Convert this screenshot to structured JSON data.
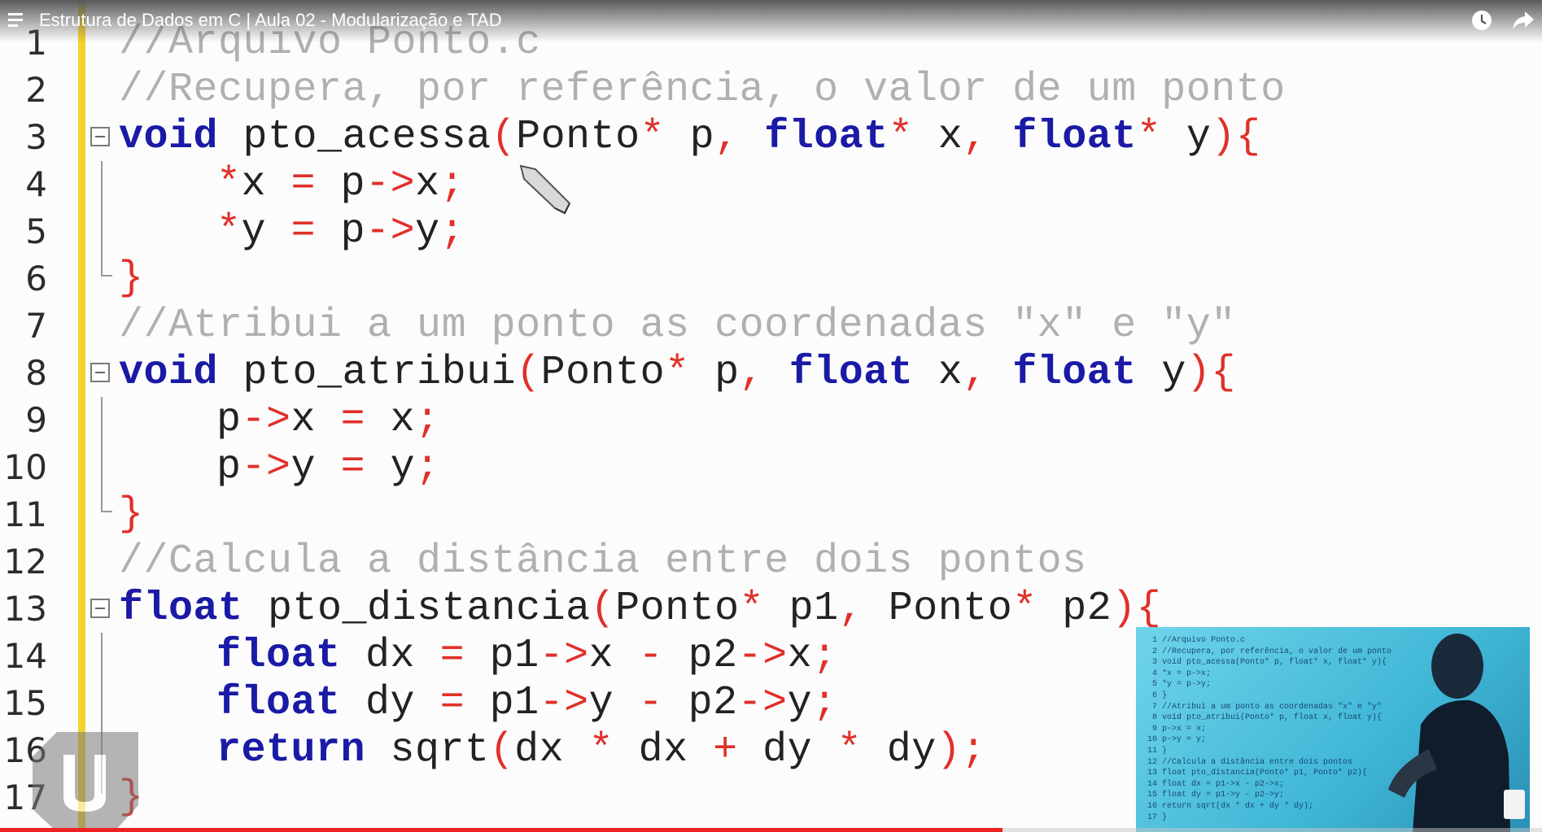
{
  "video": {
    "title": "Estrutura de Dados em C | Aula 02 - Modularização e TAD",
    "progress": 0.65
  },
  "icons": {
    "menu": "playlist-menu-icon",
    "clock": "watch-later-clock-icon",
    "share": "share-arrow-icon"
  },
  "colors": {
    "keyword": "#1a1aa6",
    "operator": "#e0302a",
    "comment": "#b0b0b0",
    "gutter": "#f2d22b",
    "progress": "#e22222"
  },
  "code": {
    "lines": [
      {
        "num": "1",
        "text": "//Arquivo Ponto.c"
      },
      {
        "num": "2",
        "text": "//Recupera, por referência, o valor de um ponto"
      },
      {
        "num": "3",
        "text": "void pto_acessa(Ponto* p, float* x, float* y){"
      },
      {
        "num": "4",
        "text": "*x = p->x;"
      },
      {
        "num": "5",
        "text": "*y = p->y;"
      },
      {
        "num": "6",
        "text": "}"
      },
      {
        "num": "7",
        "text": "//Atribui a um ponto as coordenadas \"x\" e \"y\""
      },
      {
        "num": "8",
        "text": "void pto_atribui(Ponto* p, float x, float y){"
      },
      {
        "num": "9",
        "text": "p->x = x;"
      },
      {
        "num": "10",
        "text": "p->y = y;"
      },
      {
        "num": "11",
        "text": "}"
      },
      {
        "num": "12",
        "text": "//Calcula a distância entre dois pontos"
      },
      {
        "num": "13",
        "text": "float pto_distancia(Ponto* p1, Ponto* p2){"
      },
      {
        "num": "14",
        "text": "float dx = p1->x - p2->x;"
      },
      {
        "num": "15",
        "text": "float dy = p1->y - p2->y;"
      },
      {
        "num": "16",
        "text": "return sqrt(dx * dx + dy * dy);"
      },
      {
        "num": "17",
        "text": "}"
      }
    ]
  }
}
